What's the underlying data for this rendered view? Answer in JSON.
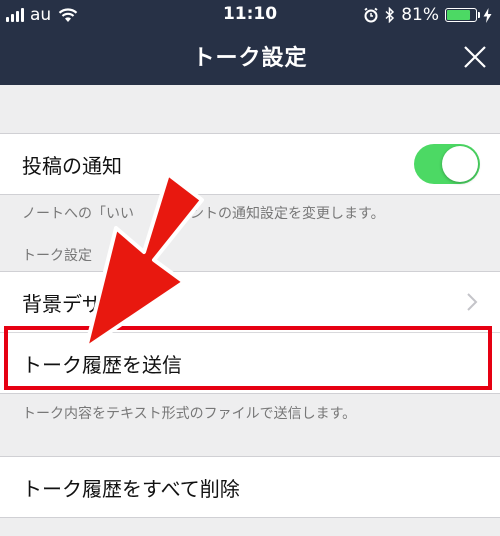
{
  "status_bar": {
    "carrier": "au",
    "time": "11:10",
    "battery_percent": "81%",
    "battery_level": 0.81,
    "icons": [
      "signal-icon",
      "wifi-icon",
      "alarm-icon",
      "bluetooth-icon",
      "battery-icon",
      "charging-icon"
    ]
  },
  "navbar": {
    "title": "トーク設定",
    "close_icon": "close-icon"
  },
  "settings": {
    "notification_label": "投稿の通知",
    "notification_enabled": true,
    "notification_note": "ノートへの「いい　　コメントの通知設定を変更します。",
    "section_header": "トーク設定",
    "background_label": "背景デザ",
    "send_history_label": "トーク履歴を送信",
    "send_history_note": "トーク内容をテキスト形式のファイルで送信します。",
    "delete_history_label": "トーク履歴をすべて削除"
  },
  "colors": {
    "navbar_bg": "#273146",
    "toggle_on": "#4cd964",
    "highlight": "#e60012",
    "arrow": "#e8180f"
  }
}
